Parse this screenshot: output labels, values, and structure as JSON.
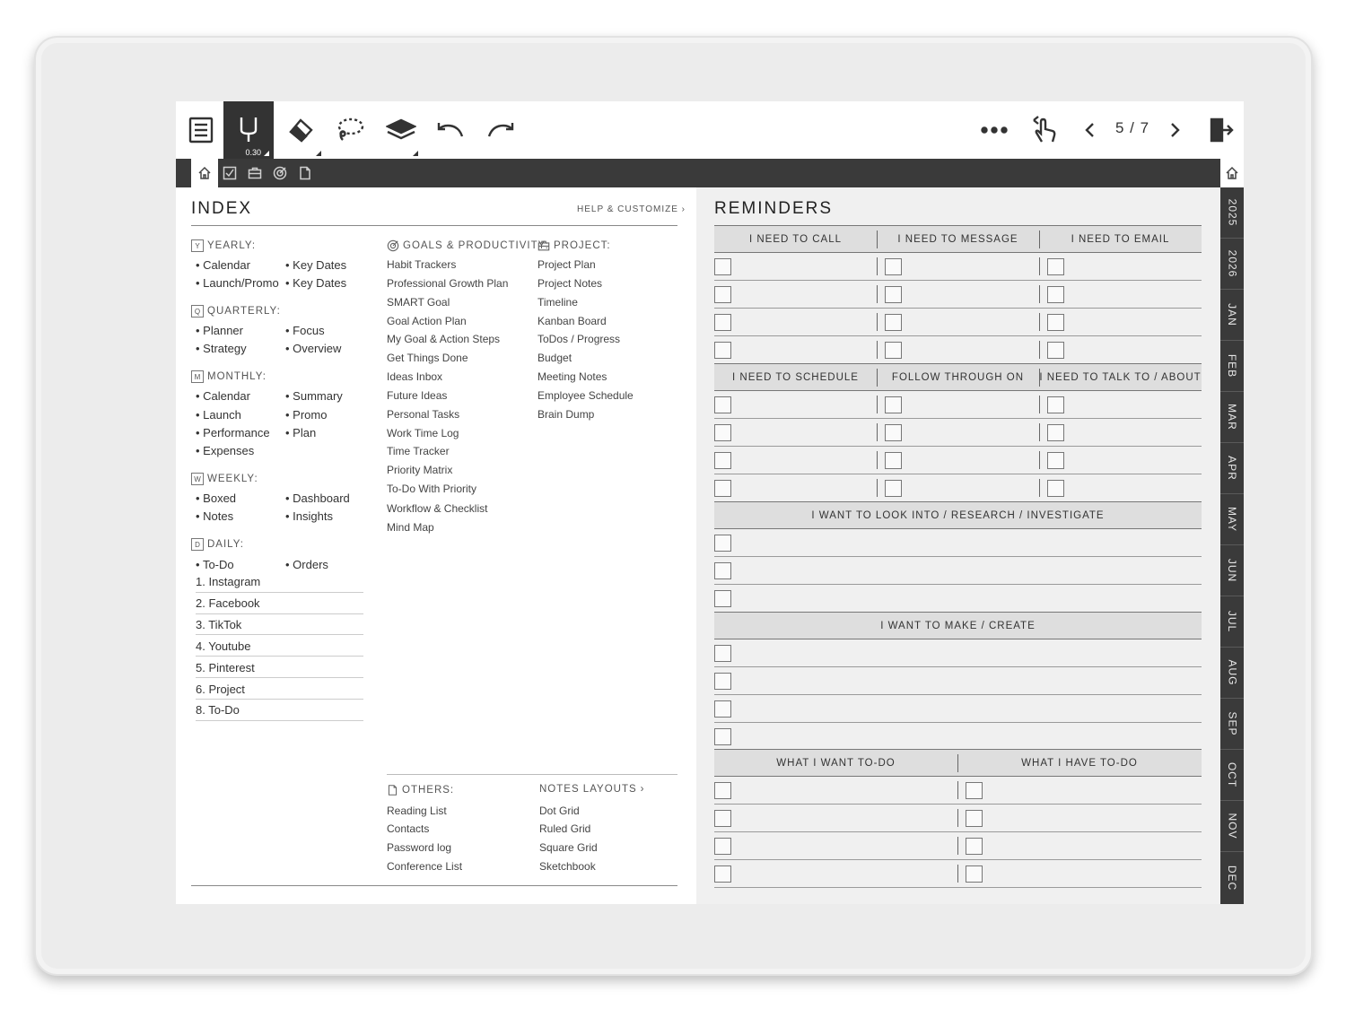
{
  "toolbar": {
    "pen_size": "0.30",
    "page_indicator": "5 / 7",
    "icons": [
      "menu-icon",
      "pen-icon",
      "eraser-icon",
      "lasso-icon",
      "layers-icon",
      "undo-icon",
      "redo-icon",
      "more-icon",
      "touch-icon",
      "prev-page-icon",
      "next-page-icon",
      "exit-icon"
    ]
  },
  "tabs": [
    "home",
    "tasks",
    "project",
    "goals",
    "notes"
  ],
  "months": [
    "2025",
    "2026",
    "JAN",
    "FEB",
    "MAR",
    "APR",
    "MAY",
    "JUN",
    "JUL",
    "AUG",
    "SEP",
    "OCT",
    "NOV",
    "DEC"
  ],
  "index": {
    "title": "INDEX",
    "help": "HELP & CUSTOMIZE",
    "yearly": {
      "label": "YEARLY:",
      "icon": "Y",
      "items": [
        "Calendar",
        "Key Dates",
        "Launch/Promo",
        "Key Dates"
      ]
    },
    "quarterly": {
      "label": "QUARTERLY:",
      "icon": "Q",
      "items": [
        "Planner",
        "Focus",
        "Strategy",
        "Overview"
      ]
    },
    "monthly": {
      "label": "MONTHLY:",
      "icon": "M",
      "items": [
        "Calendar",
        "Summary",
        "Launch",
        "Promo",
        "Performance",
        "Plan",
        "Expenses"
      ]
    },
    "weekly": {
      "label": "WEEKLY:",
      "icon": "W",
      "items": [
        "Boxed",
        "Dashboard",
        "Notes",
        "Insights"
      ]
    },
    "daily": {
      "label": "DAILY:",
      "icon": "D",
      "items": [
        "To-Do",
        "Orders"
      ],
      "numbered": [
        "1. Instagram",
        "2. Facebook",
        "3. TikTok",
        "4. Youtube",
        "5. Pinterest",
        "6. Project",
        "8. To-Do"
      ]
    },
    "goals": {
      "label": "GOALS & PRODUCTIVITY:",
      "items": [
        "Habit Trackers",
        "Professional Growth Plan",
        "SMART Goal",
        "Goal Action Plan",
        "My Goal & Action Steps",
        "Get Things Done",
        "Ideas Inbox",
        "Future Ideas",
        "Personal Tasks",
        "Work Time Log",
        "Time Tracker",
        "Priority Matrix",
        "To-Do With Priority",
        "Workflow & Checklist",
        "Mind Map"
      ]
    },
    "project": {
      "label": "PROJECT:",
      "items": [
        "Project Plan",
        "Project Notes",
        "Timeline",
        "Kanban Board",
        "ToDos / Progress",
        "Budget",
        "Meeting Notes",
        "Employee Schedule",
        "Brain Dump"
      ]
    },
    "others": {
      "label": "OTHERS:",
      "items": [
        "Reading List",
        "Contacts",
        "Password log",
        "Conference List"
      ]
    },
    "notes_layouts": {
      "label": "NOTES LAYOUTS",
      "items": [
        "Dot Grid",
        "Ruled Grid",
        "Square Grid",
        "Sketchbook"
      ]
    }
  },
  "reminders": {
    "title": "REMINDERS",
    "headers1": [
      "I NEED TO CALL",
      "I NEED TO MESSAGE",
      "I NEED TO EMAIL"
    ],
    "headers2": [
      "I NEED TO SCHEDULE",
      "FOLLOW THROUGH ON",
      "I NEED TO TALK TO / ABOUT"
    ],
    "header3": "I WANT TO LOOK INTO / RESEARCH / INVESTIGATE",
    "header4": "I WANT TO MAKE / CREATE",
    "headers5": [
      "WHAT I WANT TO-DO",
      "WHAT I HAVE TO-DO"
    ]
  }
}
